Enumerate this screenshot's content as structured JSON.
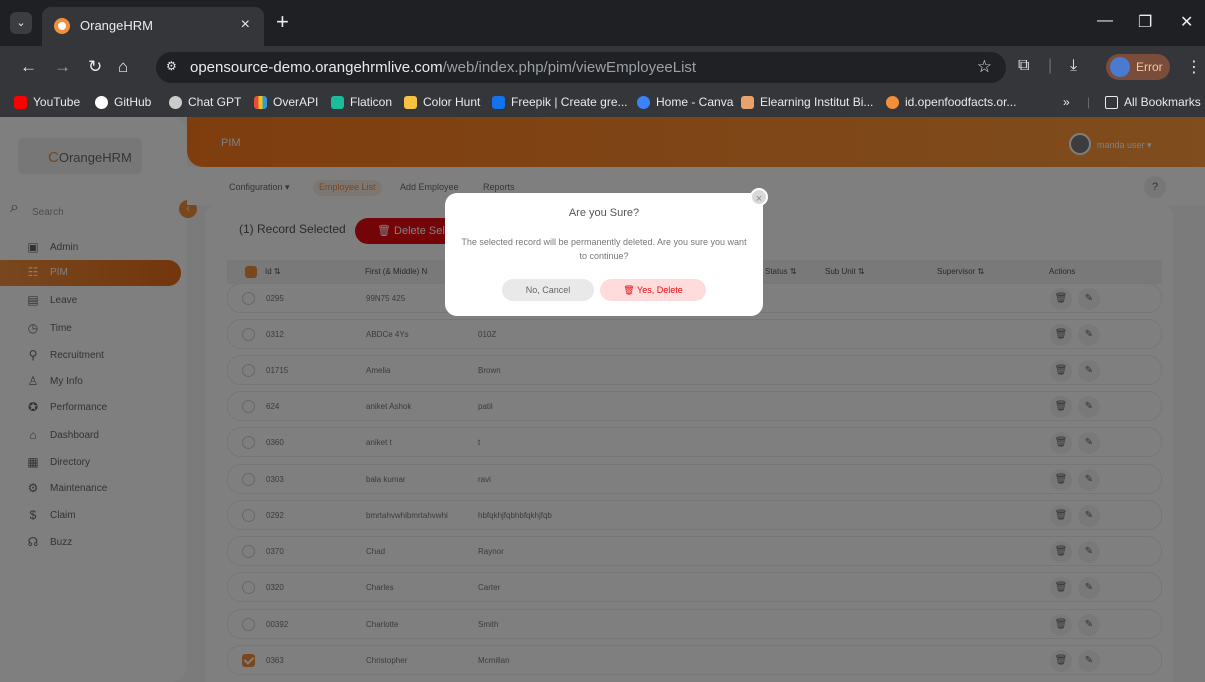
{
  "browser": {
    "tab_title": "OrangeHRM",
    "url_host": "opensource-demo.orangehrmlive.com",
    "url_path": "/web/index.php/pim/viewEmployeeList",
    "profile_label": "Error",
    "bookmarks": [
      "YouTube",
      "GitHub",
      "Chat GPT",
      "OverAPI",
      "Flaticon",
      "Color Hunt",
      "Freepik | Create gre...",
      "Home - Canva",
      "Elearning Institut Bi...",
      "id.openfoodfacts.or..."
    ],
    "all_bookmarks": "All Bookmarks",
    "icons": [
      "chevron-down-icon",
      "close-icon",
      "plus-icon",
      "back-icon",
      "forward-icon",
      "reload-icon",
      "home-icon",
      "star-icon",
      "extensions-icon",
      "download-icon",
      "more-icon"
    ]
  },
  "sidebar": {
    "brand": "OrangeHRM",
    "search_placeholder": "Search",
    "items": [
      {
        "label": "Admin",
        "icon": "admin-icon"
      },
      {
        "label": "PIM",
        "icon": "pim-icon"
      },
      {
        "label": "Leave",
        "icon": "leave-icon"
      },
      {
        "label": "Time",
        "icon": "time-icon"
      },
      {
        "label": "Recruitment",
        "icon": "recruitment-icon"
      },
      {
        "label": "My Info",
        "icon": "my-info-icon"
      },
      {
        "label": "Performance",
        "icon": "performance-icon"
      },
      {
        "label": "Dashboard",
        "icon": "dashboard-icon"
      },
      {
        "label": "Directory",
        "icon": "directory-icon"
      },
      {
        "label": "Maintenance",
        "icon": "maintenance-icon"
      },
      {
        "label": "Claim",
        "icon": "claim-icon"
      },
      {
        "label": "Buzz",
        "icon": "buzz-icon"
      }
    ]
  },
  "topbar": {
    "title": "PIM",
    "user_name": "manda user ▾"
  },
  "subnav": {
    "items": [
      "Configuration ▾",
      "Employee List",
      "Add Employee",
      "Reports"
    ],
    "help": "?"
  },
  "list": {
    "selected_count": "(1) Record Selected",
    "delete_selected": "Delete Selec",
    "headers": {
      "id": "Id ⇅",
      "first_name": "First (& Middle) N",
      "status": "Status ⇅",
      "sub_unit": "Sub Unit ⇅",
      "supervisor": "Supervisor ⇅",
      "actions": "Actions"
    },
    "rows": [
      {
        "id": "0295",
        "first": "99N75 425",
        "last": ""
      },
      {
        "id": "0312",
        "first": "ABDCe 4Ys",
        "last": "010Z"
      },
      {
        "id": "01715",
        "first": "Amelia",
        "last": "Brown"
      },
      {
        "id": "624",
        "first": "aniket Ashok",
        "last": "patil"
      },
      {
        "id": "0360",
        "first": "aniket t",
        "last": "t"
      },
      {
        "id": "0303",
        "first": "bala kumar",
        "last": "ravi"
      },
      {
        "id": "0292",
        "first": "bmrtahvwhibmrtahvwhi",
        "last": "hbfqkhjfqbhbfqkhjfqb"
      },
      {
        "id": "0370",
        "first": "Chad",
        "last": "Raynor"
      },
      {
        "id": "0320",
        "first": "Charles",
        "last": "Carter"
      },
      {
        "id": "00392",
        "first": "Charlotte",
        "last": "Smith"
      },
      {
        "id": "0363",
        "first": "Christopher",
        "last": "Mcmillan"
      }
    ]
  },
  "modal": {
    "title": "Are you Sure?",
    "body": "The selected record will be permanently deleted. Are you sure you want to continue?",
    "cancel": "No, Cancel",
    "confirm": "Yes, Delete",
    "close": "×"
  },
  "colors": {
    "brand_orange": "#f28f3b",
    "danger_red": "#eb0910"
  }
}
